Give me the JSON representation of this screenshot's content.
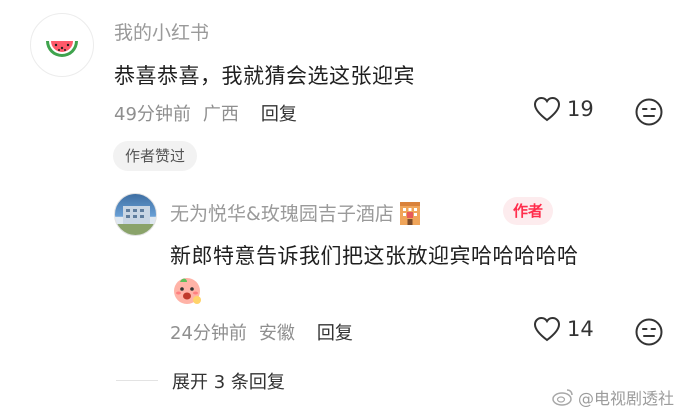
{
  "top_comment": {
    "username": "我的小红书",
    "text": "恭喜恭喜，我就猜会选这张迎宾",
    "time": "49分钟前",
    "location": "广西",
    "reply_label": "回复",
    "likes": "19",
    "author_liked_label": "作者赞过"
  },
  "reply": {
    "username": "无为悦华&玫瑰园吉子酒店",
    "badge": "作者",
    "text": "新郎特意告诉我们把这张放迎宾哈哈哈哈哈",
    "time": "24分钟前",
    "location": "安徽",
    "reply_label": "回复",
    "likes": "14"
  },
  "expand_label": "展开 3 条回复",
  "watermark": "@电视剧透社",
  "icons": {
    "avatar1": "watermelon-icon",
    "like": "heart-icon",
    "emoji_button": "neutral-face-icon",
    "hotel": "hotel-icon",
    "peach": "peach-emoji-icon",
    "weibo": "weibo-logo-icon"
  },
  "colors": {
    "author_badge_text": "#ff2e4d",
    "author_badge_bg": "#fdecee",
    "muted_text": "#9a9a9a"
  }
}
